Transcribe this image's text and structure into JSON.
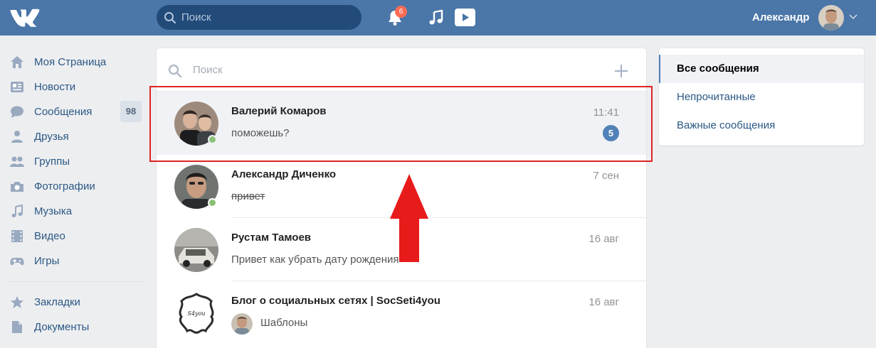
{
  "header": {
    "search_placeholder": "Поиск",
    "notifications_count": "6",
    "user_name": "Александр"
  },
  "nav": {
    "items": [
      {
        "label": "Моя Страница",
        "icon": "home-icon"
      },
      {
        "label": "Новости",
        "icon": "news-icon"
      },
      {
        "label": "Сообщения",
        "icon": "messages-icon",
        "badge": "98"
      },
      {
        "label": "Друзья",
        "icon": "friends-icon"
      },
      {
        "label": "Группы",
        "icon": "groups-icon"
      },
      {
        "label": "Фотографии",
        "icon": "camera-icon"
      },
      {
        "label": "Музыка",
        "icon": "music-icon"
      },
      {
        "label": "Видео",
        "icon": "video-icon"
      },
      {
        "label": "Игры",
        "icon": "gamepad-icon"
      }
    ],
    "items2": [
      {
        "label": "Закладки",
        "icon": "star-icon"
      },
      {
        "label": "Документы",
        "icon": "document-icon"
      }
    ]
  },
  "messages": {
    "search_placeholder": "Поиск",
    "dialogs": [
      {
        "name": "Валерий Комаров",
        "time": "11:41",
        "text": "поможешь?",
        "unread": "5",
        "online": true,
        "active": true
      },
      {
        "name": "Александр Диченко",
        "time": "7 сен",
        "text": "привет",
        "online": true,
        "strike": true
      },
      {
        "name": "Рустам Тамоев",
        "time": "16 авг",
        "text": "Привет как убрать дату рождения"
      },
      {
        "name": "Блог о социальных сетях | SocSeti4you",
        "time": "16 авг",
        "text": "Шаблоны"
      }
    ]
  },
  "filters": {
    "items": [
      "Все сообщения",
      "Непрочитанные",
      "Важные сообщения"
    ]
  },
  "colors": {
    "header_bg": "#4a76a8",
    "link": "#2a5885",
    "accent": "#5181b8",
    "highlight_red": "#e02323"
  }
}
